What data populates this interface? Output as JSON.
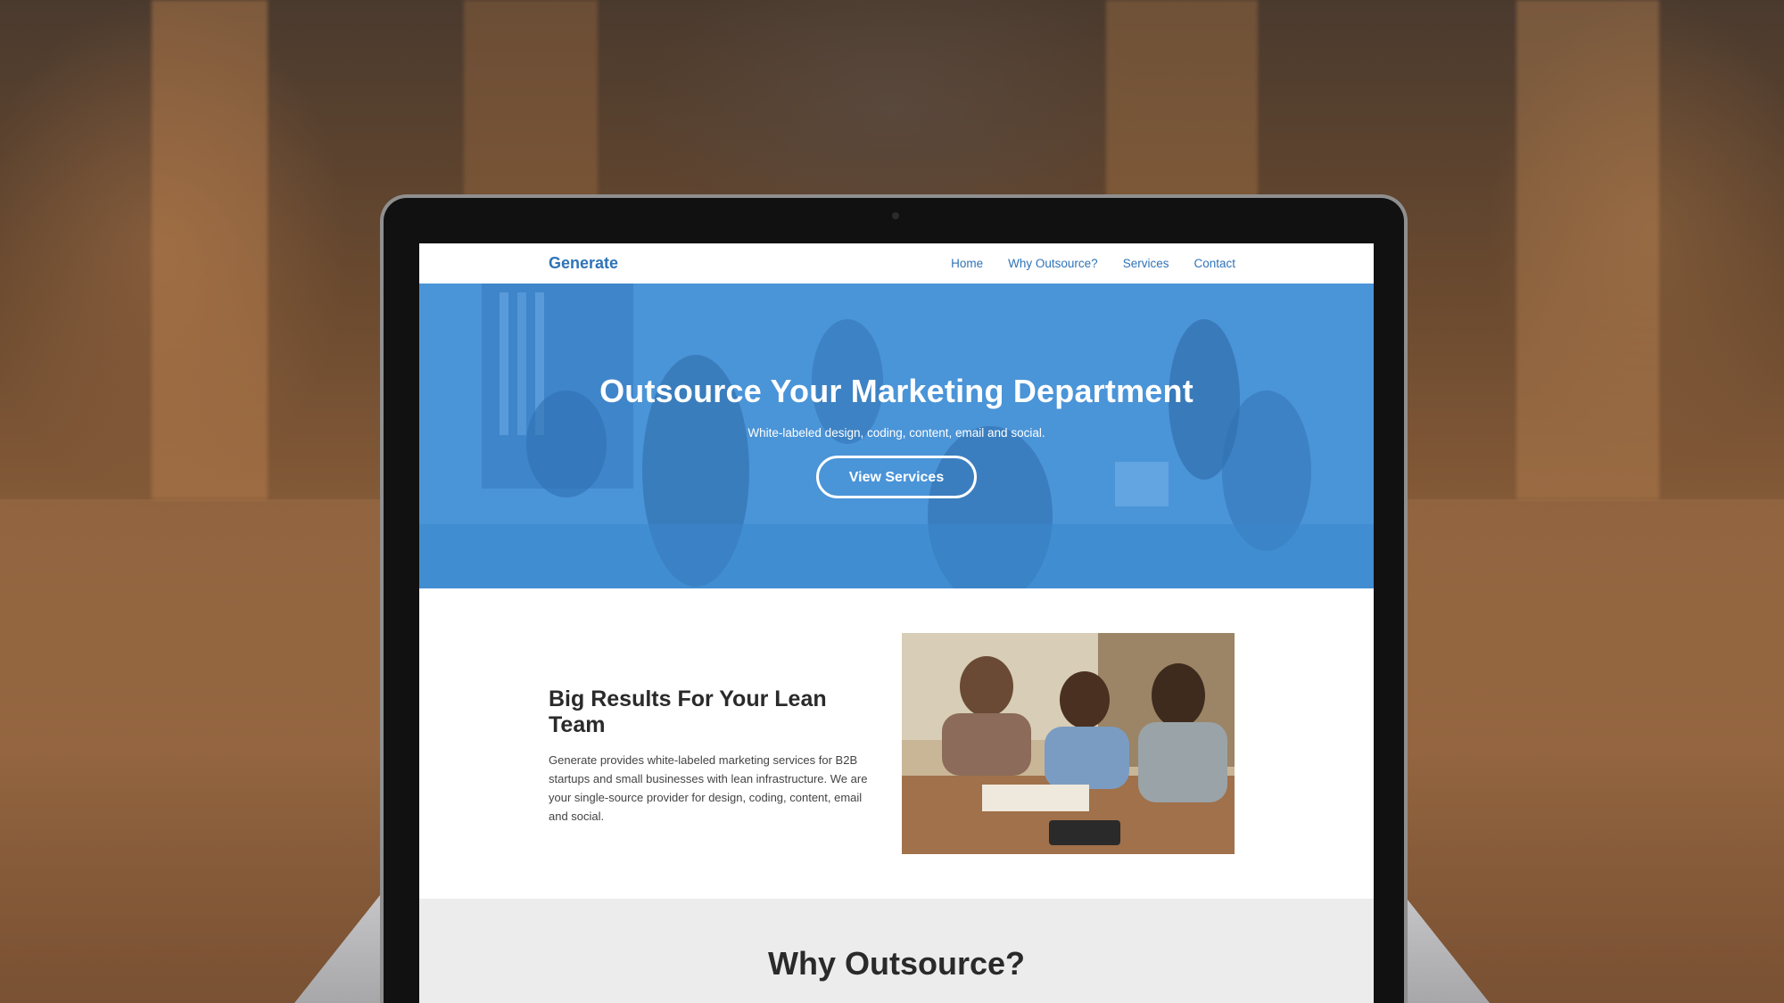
{
  "site": {
    "logo": "Generate",
    "nav": [
      "Home",
      "Why Outsource?",
      "Services",
      "Contact"
    ]
  },
  "hero": {
    "title": "Outsource Your Marketing Department",
    "subtitle": "White-labeled design, coding, content, email and social.",
    "cta_label": "View Services"
  },
  "intro": {
    "title": "Big Results For Your Lean Team",
    "body": "Generate provides white-labeled marketing services for B2B startups and small businesses with lean infrastructure. We are your single-source provider for design, coding, content, email and social."
  },
  "why": {
    "title": "Why Outsource?"
  },
  "colors": {
    "brand_blue": "#2f73b8",
    "hero_blue": "#3f8fd6",
    "section_gray": "#ececec"
  }
}
